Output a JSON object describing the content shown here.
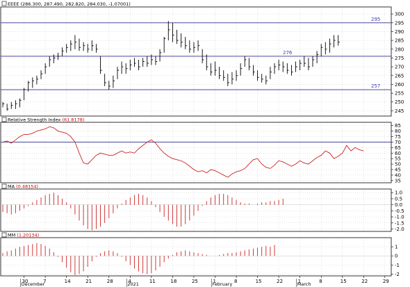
{
  "colors": {
    "frame": "#000000",
    "grid": "#c8c8c8",
    "price_bars": "#000000",
    "hline": "#2e2e8a",
    "hline_text": "#3b3bb0",
    "rsi_line": "#cc2222",
    "osc_bars": "#cc2222",
    "label_red": "#cc0000",
    "label_black": "#000000"
  },
  "chart_data": [
    {
      "type": "ohlc",
      "panel": "price",
      "header": {
        "symbol": "EEEE",
        "values": "(286.300, 287.490, 282.820, 284.030, -1.07001)"
      },
      "ylim": [
        242,
        304
      ],
      "yticks": [
        245,
        250,
        255,
        260,
        265,
        270,
        275,
        280,
        285,
        290,
        295,
        300
      ],
      "horizontal_lines": [
        {
          "value": 295,
          "label": "295",
          "label_position": "right"
        },
        {
          "value": 276,
          "label": "276",
          "label_position": "center"
        },
        {
          "value": 257,
          "label": "257",
          "label_position": "right"
        }
      ],
      "bars": [
        [
          250,
          247,
          249
        ],
        [
          249,
          245,
          246
        ],
        [
          250,
          246,
          248
        ],
        [
          251,
          246,
          249
        ],
        [
          252,
          247,
          251
        ],
        [
          258,
          251,
          257
        ],
        [
          262,
          256,
          261
        ],
        [
          264,
          258,
          262
        ],
        [
          265,
          260,
          263
        ],
        [
          268,
          263,
          266
        ],
        [
          272,
          266,
          270
        ],
        [
          276,
          270,
          274
        ],
        [
          277,
          272,
          275
        ],
        [
          278,
          274,
          276
        ],
        [
          281,
          276,
          279
        ],
        [
          283,
          278,
          281
        ],
        [
          285,
          279,
          283
        ],
        [
          288,
          280,
          284
        ],
        [
          286,
          279,
          281
        ],
        [
          284,
          279,
          282
        ],
        [
          283,
          278,
          280
        ],
        [
          285,
          279,
          282
        ],
        [
          283,
          278,
          280
        ],
        [
          276,
          266,
          268
        ],
        [
          266,
          259,
          261
        ],
        [
          262,
          257,
          259
        ],
        [
          265,
          258,
          262
        ],
        [
          270,
          263,
          268
        ],
        [
          273,
          266,
          270
        ],
        [
          272,
          266,
          269
        ],
        [
          274,
          268,
          271
        ],
        [
          275,
          270,
          272
        ],
        [
          274,
          268,
          270
        ],
        [
          275,
          270,
          273
        ],
        [
          276,
          270,
          272
        ],
        [
          277,
          271,
          274
        ],
        [
          276,
          271,
          273
        ],
        [
          280,
          273,
          278
        ],
        [
          287,
          278,
          286
        ],
        [
          296,
          285,
          291
        ],
        [
          295,
          284,
          288
        ],
        [
          291,
          283,
          285
        ],
        [
          289,
          281,
          284
        ],
        [
          287,
          280,
          282
        ],
        [
          285,
          278,
          280
        ],
        [
          284,
          278,
          281
        ],
        [
          285,
          279,
          282
        ],
        [
          280,
          272,
          274
        ],
        [
          277,
          268,
          270
        ],
        [
          272,
          265,
          267
        ],
        [
          273,
          265,
          268
        ],
        [
          270,
          263,
          265
        ],
        [
          268,
          262,
          264
        ],
        [
          266,
          259,
          261
        ],
        [
          267,
          260,
          263
        ],
        [
          268,
          262,
          265
        ],
        [
          272,
          265,
          269
        ],
        [
          276,
          270,
          274
        ],
        [
          275,
          268,
          270
        ],
        [
          271,
          265,
          267
        ],
        [
          268,
          262,
          264
        ],
        [
          266,
          261,
          263
        ],
        [
          265,
          260,
          262
        ],
        [
          270,
          263,
          267
        ],
        [
          272,
          266,
          270
        ],
        [
          274,
          268,
          271
        ],
        [
          273,
          267,
          270
        ],
        [
          272,
          266,
          268
        ],
        [
          271,
          265,
          267
        ],
        [
          273,
          267,
          270
        ],
        [
          274,
          268,
          272
        ],
        [
          276,
          270,
          272
        ],
        [
          275,
          268,
          270
        ],
        [
          276,
          270,
          274
        ],
        [
          279,
          272,
          277
        ],
        [
          283,
          276,
          281
        ],
        [
          284,
          277,
          280
        ],
        [
          286,
          278,
          283
        ],
        [
          288,
          281,
          285
        ],
        [
          288,
          282,
          284
        ]
      ],
      "xticks": [
        {
          "label": "30",
          "index": 5
        },
        {
          "label": "7",
          "index": 10
        },
        {
          "label": "14",
          "index": 15
        },
        {
          "label": "21",
          "index": 20
        },
        {
          "label": "28",
          "index": 25
        },
        {
          "label": "4",
          "index": 30
        },
        {
          "label": "11",
          "index": 35
        },
        {
          "label": "18",
          "index": 40
        },
        {
          "label": "25",
          "index": 45
        },
        {
          "label": "1",
          "index": 50
        },
        {
          "label": "8",
          "index": 55
        },
        {
          "label": "15",
          "index": 60
        },
        {
          "label": "22",
          "index": 65
        },
        {
          "label": "1",
          "index": 70
        },
        {
          "label": "8",
          "index": 75
        },
        {
          "label": "15",
          "index": 80
        },
        {
          "label": "22",
          "index": 85
        },
        {
          "label": "29",
          "index": 90
        }
      ],
      "months": [
        {
          "label": "December",
          "index": 5
        },
        {
          "label": "2021",
          "index": 30
        },
        {
          "label": "February",
          "index": 50
        },
        {
          "label": "March",
          "index": 70
        }
      ]
    },
    {
      "type": "line",
      "panel": "rsi",
      "title": "Relative Strength Index",
      "value_label": "(61.8178)",
      "ylim": [
        33,
        88
      ],
      "yticks": [
        35,
        40,
        45,
        50,
        55,
        60,
        65,
        70,
        75,
        80,
        85
      ],
      "horizontal_lines": [
        {
          "value": 70
        }
      ],
      "values": [
        70,
        71,
        69,
        72,
        75,
        77,
        77,
        78,
        80,
        81,
        82,
        84,
        83,
        80,
        79,
        78,
        75,
        70,
        60,
        51,
        50,
        54,
        58,
        60,
        59,
        58,
        58,
        60,
        62,
        60,
        61,
        60,
        64,
        67,
        70,
        72,
        69,
        64,
        60,
        57,
        55,
        54,
        53,
        51,
        48,
        45,
        43,
        44,
        42,
        45,
        44,
        42,
        40,
        38,
        41,
        43,
        44,
        46,
        50,
        54,
        55,
        50,
        47,
        46,
        49,
        53,
        52,
        50,
        48,
        50,
        53,
        51,
        50,
        53,
        56,
        58,
        62,
        60,
        55,
        57,
        60,
        67,
        62,
        65,
        63,
        62
      ]
    },
    {
      "type": "bar",
      "panel": "oscillator1",
      "title": "MA",
      "value_label": "(0.48154)",
      "ylim": [
        -2.2,
        1.3
      ],
      "yticks": [
        -2.0,
        -1.5,
        -1.0,
        -0.5,
        0.0,
        0.5,
        1.0
      ],
      "tick_labels": [
        "-2.0",
        "-1.5",
        "-1.0",
        "-0.5",
        "0.0",
        "0.5",
        "1.0"
      ],
      "values": [
        -0.6,
        -0.7,
        -0.8,
        -0.7,
        -0.5,
        -0.3,
        -0.1,
        0.2,
        0.4,
        0.6,
        0.8,
        0.9,
        1.0,
        0.8,
        0.5,
        0.2,
        -0.3,
        -0.8,
        -1.3,
        -1.7,
        -2.0,
        -2.1,
        -2.0,
        -1.8,
        -1.5,
        -1.1,
        -0.7,
        -0.3,
        0.1,
        0.4,
        0.6,
        0.8,
        0.9,
        0.8,
        0.6,
        0.3,
        -0.2,
        -0.6,
        -1.0,
        -1.3,
        -1.6,
        -1.8,
        -1.8,
        -1.6,
        -1.3,
        -0.9,
        -0.5,
        -0.1,
        0.3,
        0.6,
        0.8,
        0.9,
        0.9,
        0.8,
        0.6,
        0.4,
        0.2,
        0.1,
        0.1,
        0.0,
        0.1,
        0.2,
        0.2,
        0.3,
        0.3,
        0.4,
        0.5
      ]
    },
    {
      "type": "bar",
      "panel": "oscillator2",
      "title": "MM",
      "value_label": "(1.20134)",
      "ylim": [
        -2.2,
        2.0
      ],
      "yticks": [
        -2,
        -1,
        0,
        1
      ],
      "tick_labels": [
        "-2",
        "-1",
        "0",
        "1"
      ],
      "values": [
        0.3,
        0.5,
        0.6,
        0.8,
        1.0,
        1.1,
        1.2,
        1.3,
        1.4,
        1.3,
        1.1,
        0.8,
        0.4,
        -0.1,
        -0.7,
        -1.3,
        -1.8,
        -2.1,
        -2.0,
        -1.7,
        -1.2,
        -0.6,
        -0.1,
        0.3,
        0.5,
        0.6,
        0.5,
        0.3,
        -0.1,
        -0.6,
        -1.0,
        -1.4,
        -1.7,
        -1.9,
        -2.0,
        -1.9,
        -1.6,
        -1.2,
        -0.7,
        -0.3,
        0.1,
        0.4,
        0.5,
        0.6,
        0.5,
        0.4,
        0.3,
        0.2,
        0.1,
        0.0,
        0.0,
        0.1,
        0.2,
        0.3,
        0.3,
        0.4,
        0.5,
        0.6,
        0.7,
        0.8,
        0.9,
        1.0,
        1.1,
        1.0,
        1.2
      ]
    }
  ]
}
